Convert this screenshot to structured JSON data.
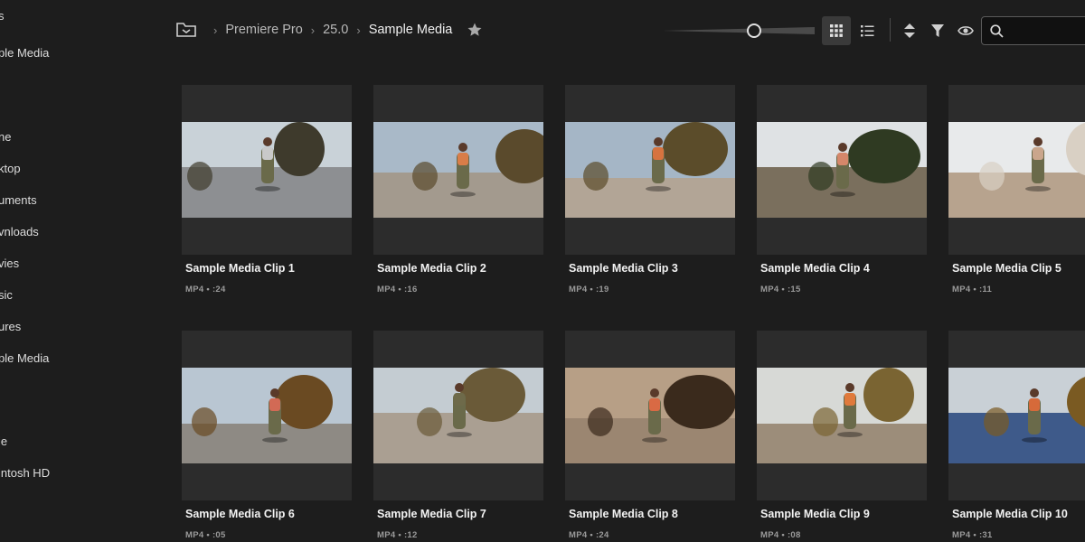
{
  "sidebar": {
    "items": [
      {
        "label": "s"
      },
      {
        "label": "ple Media"
      },
      {
        "label": "ne"
      },
      {
        "label": "ktop"
      },
      {
        "label": "uments"
      },
      {
        "label": "vnloads"
      },
      {
        "label": "vies"
      },
      {
        "label": "sic"
      },
      {
        "label": "ures"
      },
      {
        "label": "ple Media"
      },
      {
        "label": "ie"
      },
      {
        "label": "intosh HD"
      }
    ]
  },
  "breadcrumb": {
    "items": [
      "Premiere Pro",
      "25.0"
    ],
    "current": "Sample Media"
  },
  "toolbar": {
    "zoom_level": 0.6,
    "search_placeholder": ""
  },
  "clips": [
    {
      "title": "Sample Media Clip 1",
      "meta": "MP4 • :24",
      "thumb": {
        "sky": "#c9d2d8",
        "ground": "#8d8f92",
        "tree": "#3e3a2c",
        "accent": "#c9c9c9"
      }
    },
    {
      "title": "Sample Media Clip 2",
      "meta": "MP4 • :16",
      "thumb": {
        "sky": "#a9b9c8",
        "ground": "#a39a8e",
        "tree": "#5a4a2c",
        "accent": "#d97d48"
      }
    },
    {
      "title": "Sample Media Clip 3",
      "meta": "MP4 • :19",
      "thumb": {
        "sky": "#a5b6c6",
        "ground": "#b2a596",
        "tree": "#5b4c2a",
        "accent": "#d6733f"
      }
    },
    {
      "title": "Sample Media Clip 4",
      "meta": "MP4 • :15",
      "thumb": {
        "sky": "#dfe2e4",
        "ground": "#7a6f5d",
        "tree": "#2f3a22",
        "accent": "#d5876a"
      }
    },
    {
      "title": "Sample Media Clip 5",
      "meta": "MP4 • :11",
      "thumb": {
        "sky": "#e8eaeb",
        "ground": "#b7a38e",
        "tree": "#d9d0c4",
        "accent": "#caa68c"
      }
    },
    {
      "title": "Sample Media Clip 6",
      "meta": "MP4 • :05",
      "thumb": {
        "sky": "#b9c6d2",
        "ground": "#8e8a84",
        "tree": "#6a4a22",
        "accent": "#d26a55"
      }
    },
    {
      "title": "Sample Media Clip 7",
      "meta": "MP4 • :12",
      "thumb": {
        "sky": "#c4ccd2",
        "ground": "#aa9f92",
        "tree": "#6a5a38",
        "accent": "#6e6a4a"
      }
    },
    {
      "title": "Sample Media Clip 8",
      "meta": "MP4 • :24",
      "thumb": {
        "sky": "#b79f86",
        "ground": "#9b8671",
        "tree": "#3a2a1c",
        "accent": "#d96a44"
      }
    },
    {
      "title": "Sample Media Clip 9",
      "meta": "MP4 • :08",
      "thumb": {
        "sky": "#d7d9d6",
        "ground": "#9c8d7a",
        "tree": "#7a6432",
        "accent": "#e07a3c"
      }
    },
    {
      "title": "Sample Media Clip 10",
      "meta": "MP4 • :31",
      "thumb": {
        "sky": "#c9d0d6",
        "ground": "#3e5a8a",
        "tree": "#7a5a22",
        "accent": "#d66a3a"
      }
    }
  ]
}
